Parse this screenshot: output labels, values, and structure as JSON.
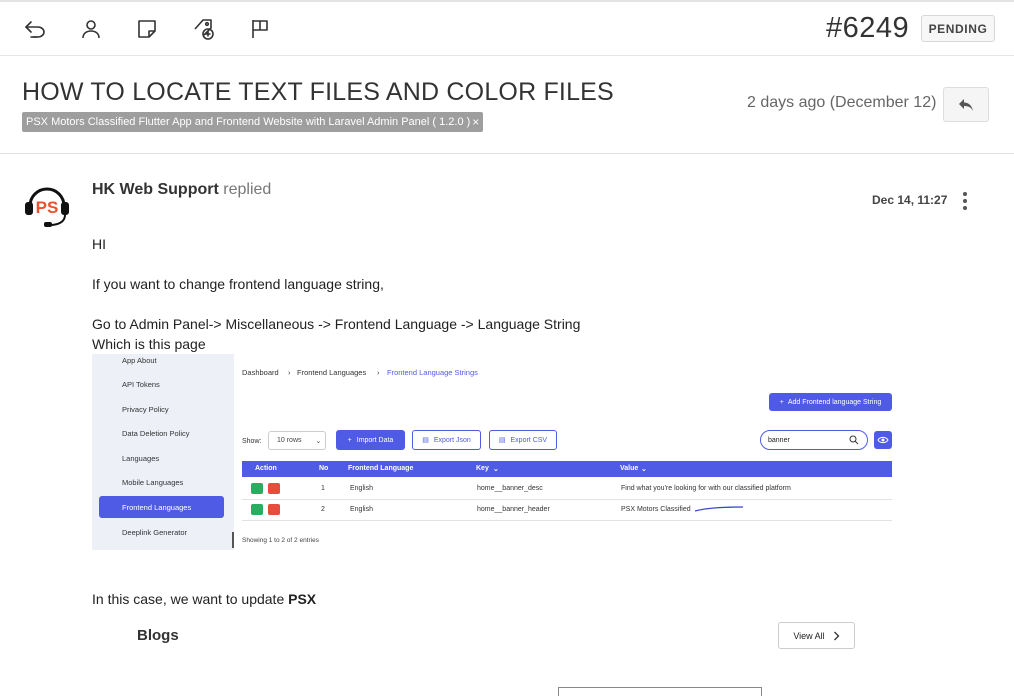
{
  "toolbar": {
    "icons": [
      "undo-icon",
      "user-icon",
      "note-icon",
      "tag-add-icon",
      "flag-icon"
    ],
    "ticket_id": "#6249",
    "status": "PENDING"
  },
  "ticket": {
    "title": "HOW TO LOCATE TEXT FILES AND COLOR FILES",
    "product_tag": "PSX Motors Classified Flutter App and Frontend Website with Laravel Admin Panel ( 1.2.0 )",
    "tag_remove": "×",
    "date": "2 days ago (December 12)"
  },
  "message": {
    "author": "HK Web Support",
    "action": "replied",
    "time": "Dec 14, 11:27",
    "lines": [
      "HI",
      "If you want to change frontend language string,",
      "Go to Admin Panel-> Miscellaneous -> Frontend Language -> Language String",
      "Which is this page"
    ],
    "after_text": "In this case, we want to update ",
    "after_bold": "PSX"
  },
  "screenshot": {
    "sidebar": [
      "App About",
      "API Tokens",
      "Privacy Policy",
      "Data Deletion Policy",
      "Languages",
      "Mobile Languages",
      "Frontend Languages",
      "Deeplink Generator"
    ],
    "breadcrumb": [
      "Dashboard",
      "Frontend Languages",
      "Frontend Language Strings"
    ],
    "add_button": "Add Frontend language String",
    "show_label": "Show:",
    "rows_select": "10 rows",
    "import_button": "Import Data",
    "export_json": "Export Json",
    "export_csv": "Export CSV",
    "search_value": "banner",
    "columns": [
      "Action",
      "No",
      "Frontend Language",
      "Key",
      "Value"
    ],
    "rows": [
      {
        "no": "1",
        "language": "English",
        "key": "home__banner_desc",
        "value": "Find what you're looking for with our classified platform"
      },
      {
        "no": "2",
        "language": "English",
        "key": "home__banner_header",
        "value": "PSX Motors Classified"
      }
    ],
    "footer": "Showing 1 to 2 of 2 entries",
    "accent": "#4f5be4"
  },
  "blogs": {
    "label": "Blogs",
    "view_all": "View All"
  }
}
